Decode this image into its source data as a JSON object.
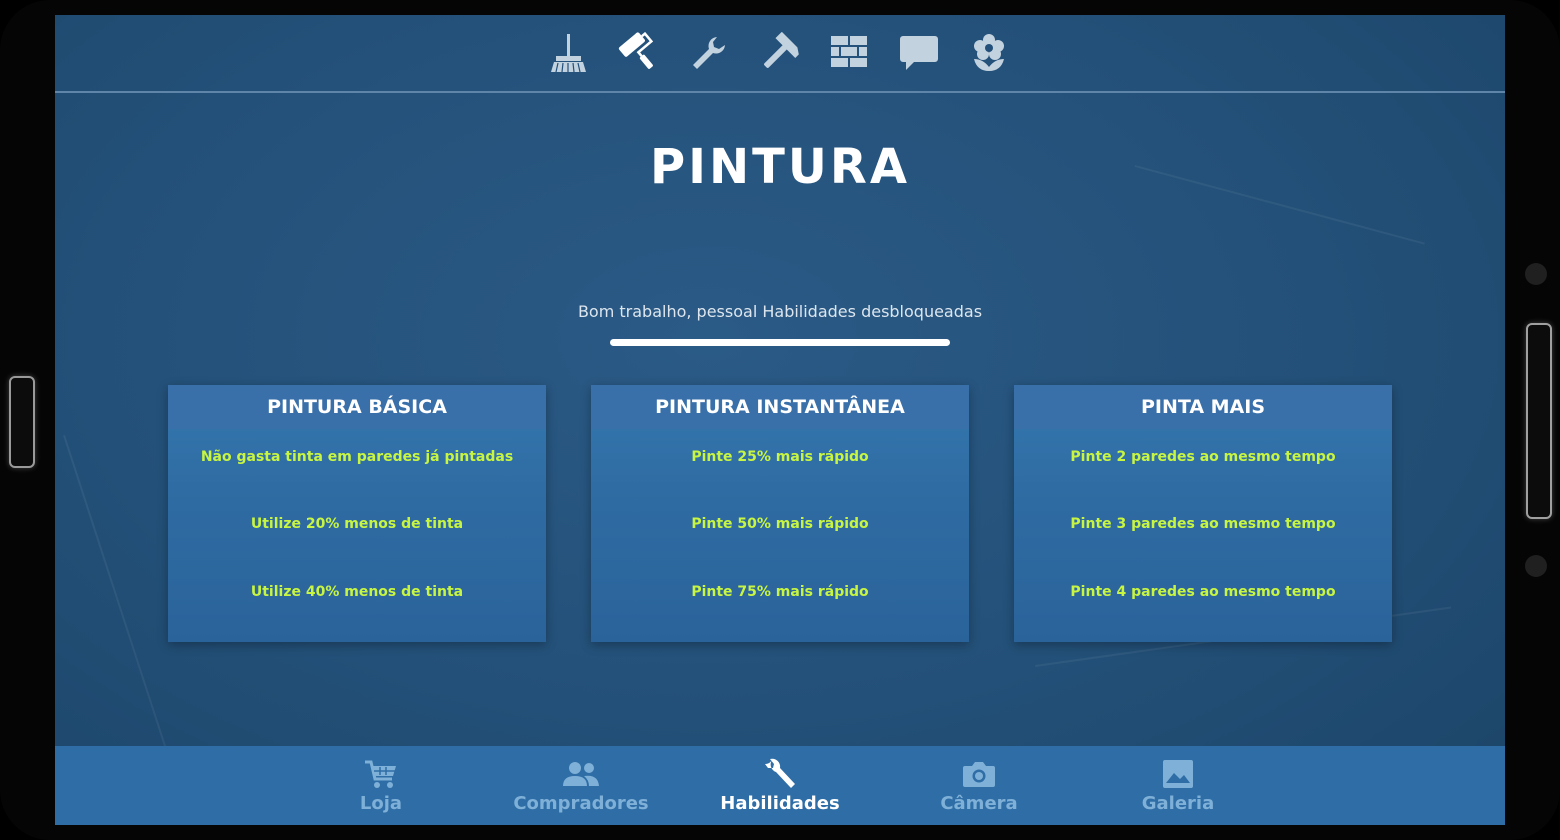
{
  "tools": [
    {
      "name": "broom-icon",
      "active": false
    },
    {
      "name": "paint-roller-icon",
      "active": true
    },
    {
      "name": "wrench-icon",
      "active": false
    },
    {
      "name": "hammer-icon",
      "active": false
    },
    {
      "name": "bricks-icon",
      "active": false
    },
    {
      "name": "speech-bubble-icon",
      "active": false
    },
    {
      "name": "flower-icon",
      "active": false
    }
  ],
  "header": {
    "title": "PINTURA"
  },
  "status": {
    "text": "Bom trabalho, pessoal Habilidades desbloqueadas",
    "progress": 1.0
  },
  "cards": [
    {
      "title": "PINTURA BÁSICA",
      "skills": [
        "Não gasta tinta em paredes já pintadas",
        "Utilize 20% menos de tinta",
        "Utilize 40% menos de tinta"
      ]
    },
    {
      "title": "PINTURA INSTANTÂNEA",
      "skills": [
        "Pinte 25% mais rápido",
        "Pinte 50% mais rápido",
        "Pinte 75% mais rápido"
      ]
    },
    {
      "title": "PINTA MAIS",
      "skills": [
        "Pinte 2 paredes ao mesmo tempo",
        "Pinte 3 paredes ao mesmo tempo",
        "Pinte 4 paredes ao mesmo tempo"
      ]
    }
  ],
  "nav": {
    "items": [
      {
        "label": "Loja",
        "icon": "cart-icon",
        "active": false
      },
      {
        "label": "Compradores",
        "icon": "people-icon",
        "active": false
      },
      {
        "label": "Habilidades",
        "icon": "wrench-icon",
        "active": true
      },
      {
        "label": "Câmera",
        "icon": "camera-icon",
        "active": false
      },
      {
        "label": "Galeria",
        "icon": "image-icon",
        "active": false
      }
    ]
  },
  "colors": {
    "accent_text": "#c8f542",
    "active_icon": "#ffffff",
    "inactive_icon": "#c3d2df",
    "nav_inactive": "#7fb0d8"
  }
}
